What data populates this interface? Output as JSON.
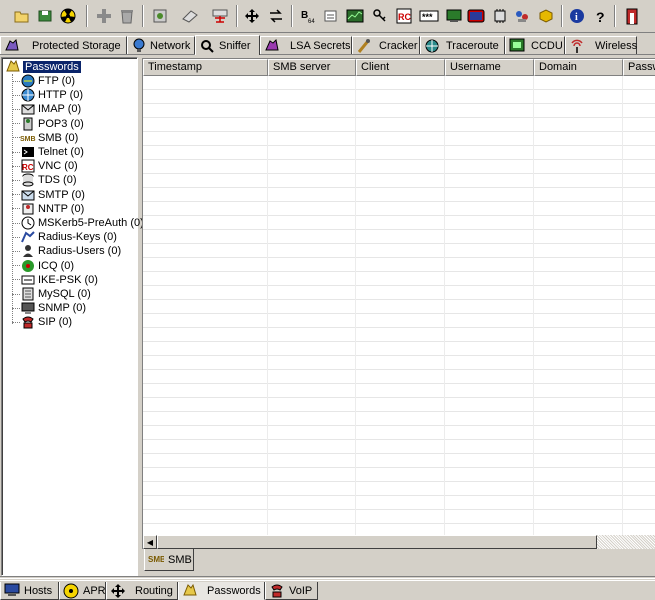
{
  "toolbar": {
    "buttons": [
      {
        "name": "open-folder-icon",
        "tip": ""
      },
      {
        "name": "save-icon",
        "tip": ""
      },
      {
        "name": "radiation-icon",
        "tip": ""
      },
      {
        "name": "add-icon",
        "tip": ""
      },
      {
        "name": "delete-icon",
        "tip": ""
      },
      {
        "name": "settings-icon",
        "tip": ""
      },
      {
        "name": "connect-icon",
        "tip": ""
      },
      {
        "name": "network-icon",
        "tip": ""
      },
      {
        "name": "move-icon",
        "tip": ""
      },
      {
        "name": "swap-icon",
        "tip": ""
      },
      {
        "name": "base64-icon",
        "tip": ""
      },
      {
        "name": "hash-icon",
        "tip": ""
      },
      {
        "name": "chart-icon",
        "tip": ""
      },
      {
        "name": "key-icon",
        "tip": ""
      },
      {
        "name": "vnc-icon",
        "tip": ""
      },
      {
        "name": "password-mask-icon",
        "tip": ""
      },
      {
        "name": "monitor-icon",
        "tip": ""
      },
      {
        "name": "display-icon",
        "tip": ""
      },
      {
        "name": "chip-icon",
        "tip": ""
      },
      {
        "name": "network-user-icon",
        "tip": ""
      },
      {
        "name": "certificate-icon",
        "tip": ""
      },
      {
        "name": "info-icon",
        "tip": ""
      },
      {
        "name": "help-icon",
        "tip": ""
      },
      {
        "name": "exit-icon",
        "tip": ""
      }
    ]
  },
  "top_tabs": [
    {
      "label": "Protected Storage",
      "icon": "protected-storage-icon"
    },
    {
      "label": "Network",
      "icon": "network-icon"
    },
    {
      "label": "Sniffer",
      "icon": "sniffer-icon"
    },
    {
      "label": "LSA Secrets",
      "icon": "lsa-icon"
    },
    {
      "label": "Cracker",
      "icon": "cracker-icon"
    },
    {
      "label": "Traceroute",
      "icon": "traceroute-icon"
    },
    {
      "label": "CCDU",
      "icon": "ccdu-icon"
    },
    {
      "label": "Wireless",
      "icon": "wireless-icon"
    }
  ],
  "tree": {
    "root": "Passwords",
    "items": [
      {
        "label": "FTP (0)",
        "icon": "ftp-icon"
      },
      {
        "label": "HTTP (0)",
        "icon": "http-icon"
      },
      {
        "label": "IMAP (0)",
        "icon": "imap-icon"
      },
      {
        "label": "POP3 (0)",
        "icon": "pop3-icon"
      },
      {
        "label": "SMB (0)",
        "icon": "smb-icon"
      },
      {
        "label": "Telnet (0)",
        "icon": "telnet-icon"
      },
      {
        "label": "VNC (0)",
        "icon": "vnc-icon"
      },
      {
        "label": "TDS (0)",
        "icon": "tds-icon"
      },
      {
        "label": "SMTP (0)",
        "icon": "smtp-icon"
      },
      {
        "label": "NNTP (0)",
        "icon": "nntp-icon"
      },
      {
        "label": "MSKerb5-PreAuth (0)",
        "icon": "kerberos-icon"
      },
      {
        "label": "Radius-Keys (0)",
        "icon": "radius-keys-icon"
      },
      {
        "label": "Radius-Users (0)",
        "icon": "radius-users-icon"
      },
      {
        "label": "ICQ (0)",
        "icon": "icq-icon"
      },
      {
        "label": "IKE-PSK (0)",
        "icon": "ike-icon"
      },
      {
        "label": "MySQL (0)",
        "icon": "mysql-icon"
      },
      {
        "label": "SNMP (0)",
        "icon": "snmp-icon"
      },
      {
        "label": "SIP (0)",
        "icon": "sip-icon"
      }
    ]
  },
  "grid": {
    "columns": [
      "Timestamp",
      "SMB server",
      "Client",
      "Username",
      "Domain",
      "Passwo"
    ]
  },
  "inner_tab": {
    "label": "SMB"
  },
  "bottom_tabs": [
    {
      "label": "Hosts",
      "icon": "hosts-icon"
    },
    {
      "label": "APR",
      "icon": "apr-icon"
    },
    {
      "label": "Routing",
      "icon": "routing-icon"
    },
    {
      "label": "Passwords",
      "icon": "passwords-icon"
    },
    {
      "label": "VoIP",
      "icon": "voip-icon"
    }
  ],
  "colors": {
    "chrome": "#d4d0c8",
    "selection": "#0a246a"
  }
}
